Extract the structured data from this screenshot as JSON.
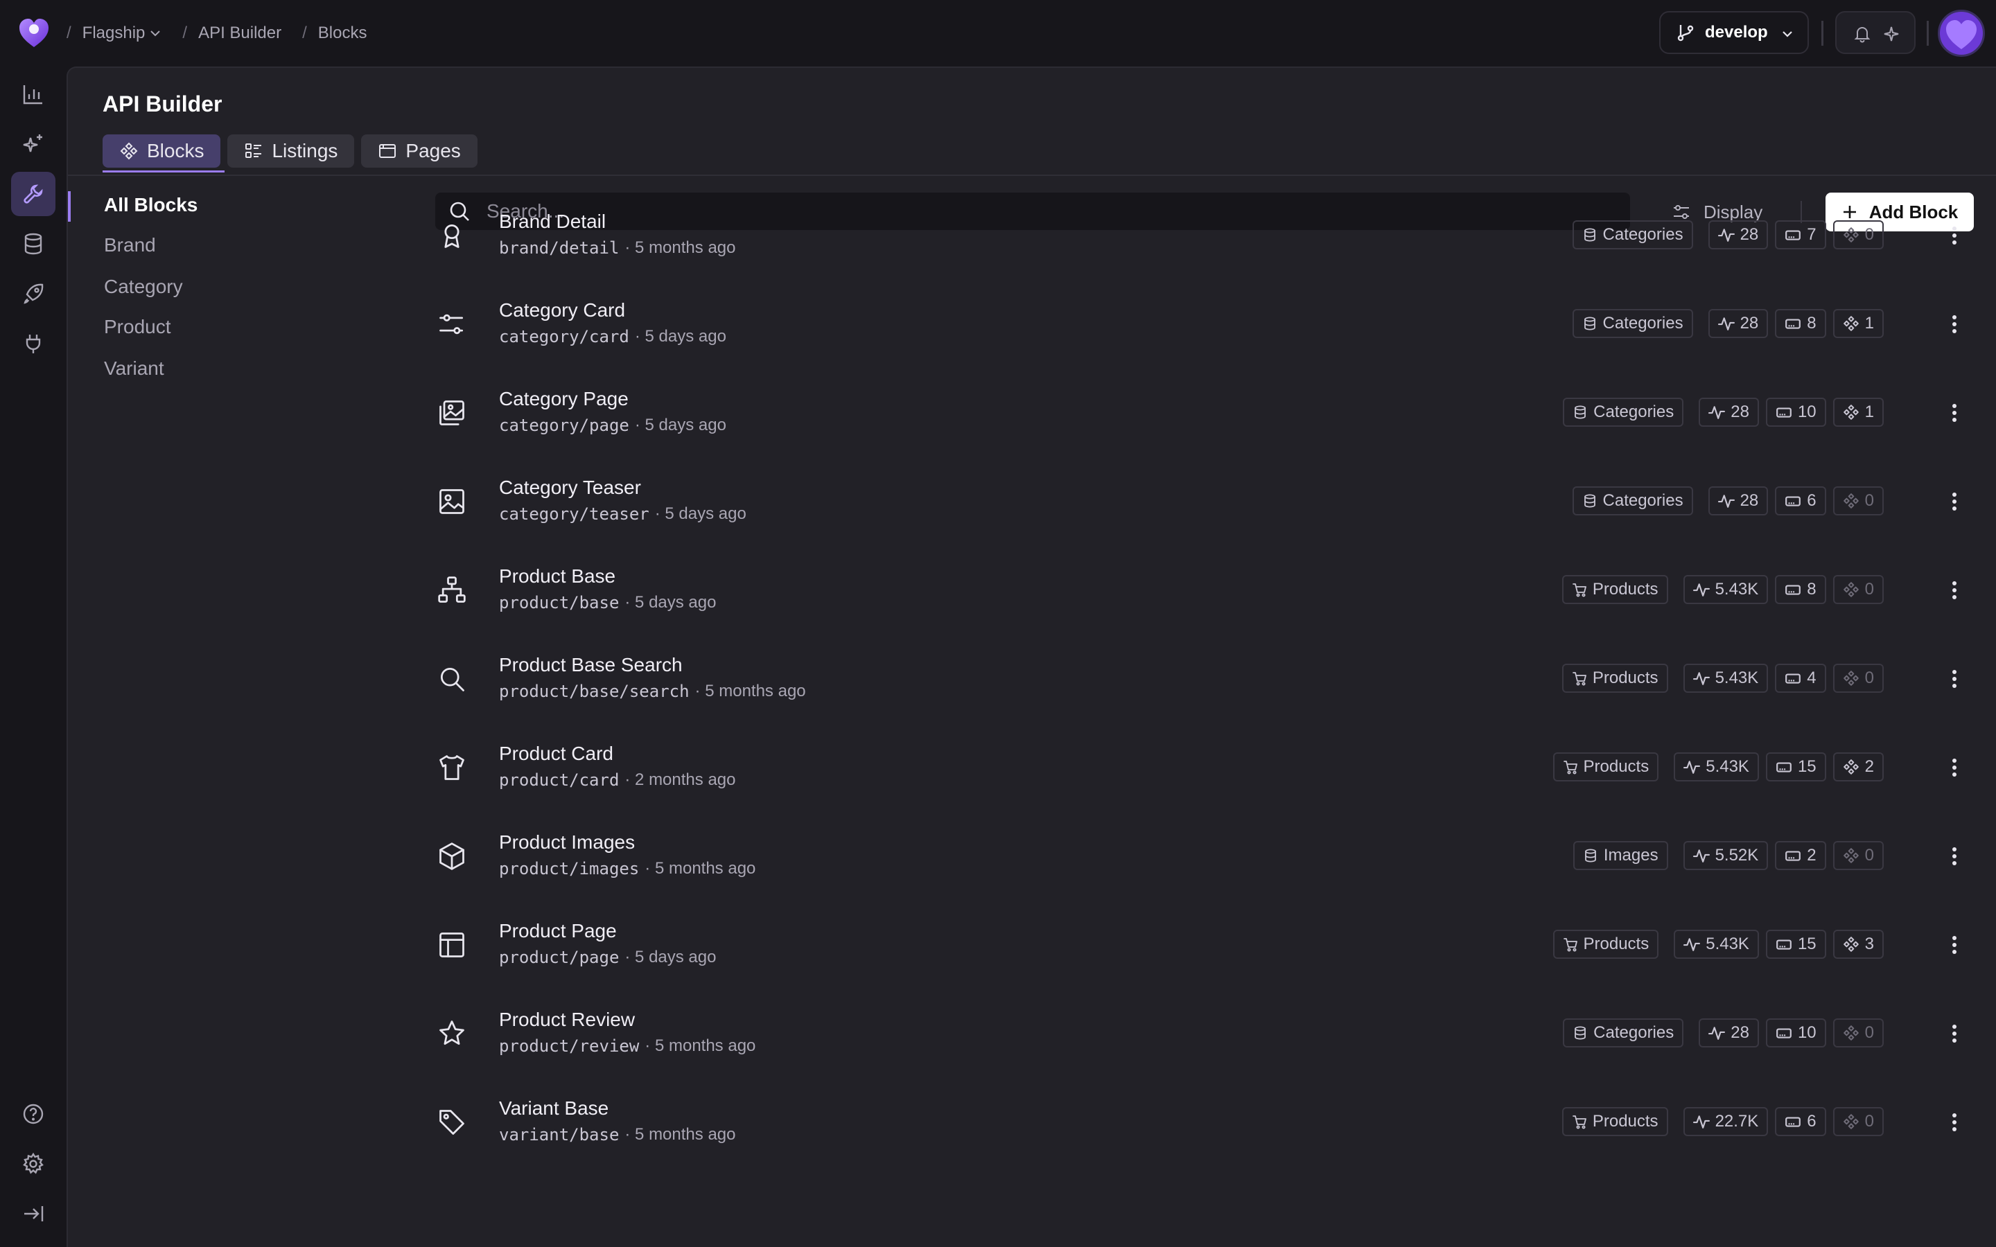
{
  "breadcrumb": {
    "items": [
      "Flagship",
      "API Builder",
      "Blocks"
    ],
    "separator": "/"
  },
  "branch": {
    "label": "develop"
  },
  "page": {
    "title": "API Builder"
  },
  "tabs": [
    {
      "label": "Blocks",
      "active": true
    },
    {
      "label": "Listings",
      "active": false
    },
    {
      "label": "Pages",
      "active": false
    }
  ],
  "subnav": {
    "items": [
      {
        "label": "All Blocks",
        "active": true
      },
      {
        "label": "Brand",
        "active": false
      },
      {
        "label": "Category",
        "active": false
      },
      {
        "label": "Product",
        "active": false
      },
      {
        "label": "Variant",
        "active": false
      }
    ]
  },
  "search": {
    "placeholder": "Search..."
  },
  "toolbar": {
    "display_label": "Display",
    "add_label": "Add Block"
  },
  "colors": {
    "accent": "#9b7df0",
    "panel": "#222127",
    "background": "#17161b"
  },
  "rows": [
    {
      "name": "Brand Detail",
      "path": "brand/detail",
      "time": "· 5 months ago",
      "icon": "award-icon",
      "source": "Categories",
      "source_icon": "database-icon",
      "requests": "28",
      "fields": "7",
      "components": "0"
    },
    {
      "name": "Category Card",
      "path": "category/card",
      "time": "· 5 days ago",
      "icon": "sliders-icon",
      "source": "Categories",
      "source_icon": "database-icon",
      "requests": "28",
      "fields": "8",
      "components": "1"
    },
    {
      "name": "Category Page",
      "path": "category/page",
      "time": "· 5 days ago",
      "icon": "images-icon",
      "source": "Categories",
      "source_icon": "database-icon",
      "requests": "28",
      "fields": "10",
      "components": "1"
    },
    {
      "name": "Category Teaser",
      "path": "category/teaser",
      "time": "· 5 days ago",
      "icon": "image-icon",
      "source": "Categories",
      "source_icon": "database-icon",
      "requests": "28",
      "fields": "6",
      "components": "0"
    },
    {
      "name": "Product Base",
      "path": "product/base",
      "time": "· 5 days ago",
      "icon": "hierarchy-icon",
      "source": "Products",
      "source_icon": "cart-icon",
      "requests": "5.43K",
      "fields": "8",
      "components": "0"
    },
    {
      "name": "Product Base Search",
      "path": "product/base/search",
      "time": "· 5 months ago",
      "icon": "search-icon",
      "source": "Products",
      "source_icon": "cart-icon",
      "requests": "5.43K",
      "fields": "4",
      "components": "0"
    },
    {
      "name": "Product Card",
      "path": "product/card",
      "time": "· 2 months ago",
      "icon": "shirt-icon",
      "source": "Products",
      "source_icon": "cart-icon",
      "requests": "5.43K",
      "fields": "15",
      "components": "2"
    },
    {
      "name": "Product Images",
      "path": "product/images",
      "time": "· 5 months ago",
      "icon": "box-icon",
      "source": "Images",
      "source_icon": "database-icon",
      "requests": "5.52K",
      "fields": "2",
      "components": "0"
    },
    {
      "name": "Product Page",
      "path": "product/page",
      "time": "· 5 days ago",
      "icon": "layout-icon",
      "source": "Products",
      "source_icon": "cart-icon",
      "requests": "5.43K",
      "fields": "15",
      "components": "3"
    },
    {
      "name": "Product Review",
      "path": "product/review",
      "time": "· 5 months ago",
      "icon": "star-icon",
      "source": "Categories",
      "source_icon": "database-icon",
      "requests": "28",
      "fields": "10",
      "components": "0"
    },
    {
      "name": "Variant Base",
      "path": "variant/base",
      "time": "· 5 months ago",
      "icon": "tag-icon",
      "source": "Products",
      "source_icon": "cart-icon",
      "requests": "22.7K",
      "fields": "6",
      "components": "0"
    }
  ]
}
